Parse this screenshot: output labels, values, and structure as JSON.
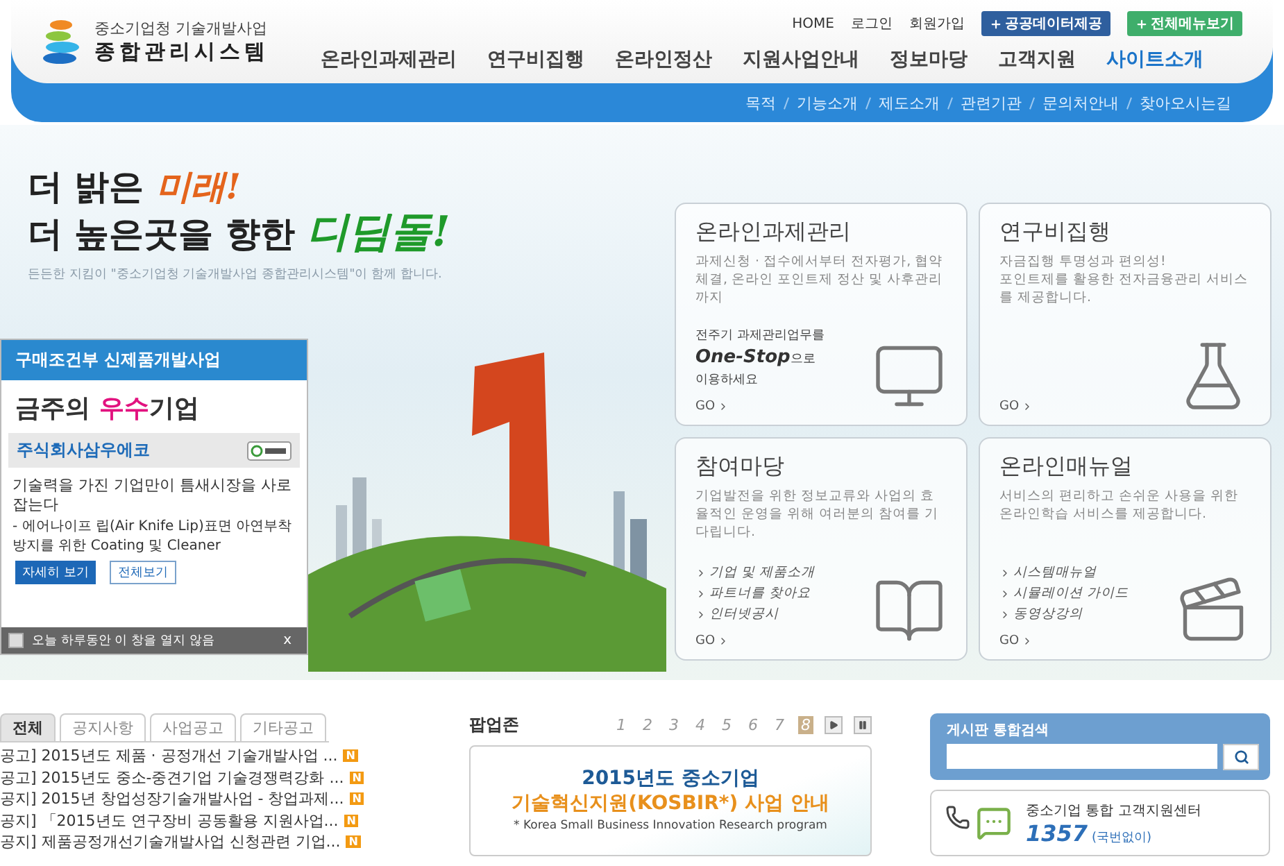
{
  "header": {
    "logo": {
      "org": "중소기업청 기술개발사업",
      "system": "종합관리시스템"
    },
    "top_links": [
      "HOME",
      "로그인",
      "회원가입"
    ],
    "top_buttons": [
      {
        "label": "공공데이터제공",
        "kind": "data"
      },
      {
        "label": "전체메뉴보기",
        "kind": "menu"
      }
    ],
    "nav": [
      {
        "label": "온라인과제관리",
        "selected": false
      },
      {
        "label": "연구비집행",
        "selected": false
      },
      {
        "label": "온라인정산",
        "selected": false
      },
      {
        "label": "지원사업안내",
        "selected": false
      },
      {
        "label": "정보마당",
        "selected": false
      },
      {
        "label": "고객지원",
        "selected": false
      },
      {
        "label": "사이트소개",
        "selected": true
      }
    ],
    "subnav": [
      "목적",
      "기능소개",
      "제도소개",
      "관련기관",
      "문의처안내",
      "찾아오시는길"
    ]
  },
  "hero": {
    "slogan": [
      {
        "lead": "더 밝은",
        "accent": "미래!",
        "color": "#e4641c"
      },
      {
        "lead": "더 높은곳을 향한",
        "accent": "디딤돌!",
        "color": "#1f9a2a"
      }
    ],
    "tagline": "든든한 지킴이 \"중소기업청 기술개발사업 종합관리시스템\"이 함께 합니다."
  },
  "popup": {
    "header": "구매조건부 신제품개발사업",
    "title": {
      "lead": "금주의",
      "accent": "우수",
      "tail": "기업"
    },
    "company": "주식회사삼우에코",
    "description": "기술력을 가진 기업만이 틈새시장을 사로잡는다",
    "detail": "- 에어나이프 립(Air Knife Lip)표면 아연부착방지를 위한 Coating 및 Cleaner",
    "buttons": [
      {
        "label": "자세히 보기",
        "kind": "primary"
      },
      {
        "label": "전체보기",
        "kind": "secondary"
      }
    ],
    "footer": {
      "label": "오늘 하루동안 이 창을 열지 않음",
      "checked": false,
      "close": "x"
    }
  },
  "cards": [
    {
      "title": "온라인과제관리",
      "description": "과제신청 · 접수에서부터 전자평가, 협약체결, 온라인 포인트제 정산 및 사후관리까지",
      "kind": "promo",
      "promo": {
        "line1": "전주기 과제관리업무를",
        "highlight": "One-Stop",
        "suffix": "으로",
        "line3": "이용하세요"
      },
      "go": "GO"
    },
    {
      "title": "연구비집행",
      "description": "자금집행 투명성과 편의성!\n포인트제를 활용한 전자금융관리 서비스를 제공합니다.",
      "kind": "plain",
      "go": "GO"
    },
    {
      "title": "참여마당",
      "description": "기업발전을 위한 정보교류와 사업의 효율적인 운영을 위해 여러분의 참여를 기다립니다.",
      "kind": "links",
      "links": [
        "기업 및 제품소개",
        "파트너를 찾아요",
        "인터넷공시"
      ],
      "go": "GO"
    },
    {
      "title": "온라인매뉴얼",
      "description": "서비스의 편리하고 손쉬운 사용을 위한 온라인학습 서비스를 제공합니다.",
      "kind": "links",
      "links": [
        "시스템매뉴얼",
        "시뮬레이션 가이드",
        "동영상강의"
      ],
      "go": "GO"
    }
  ],
  "notices": {
    "tabs": [
      {
        "label": "전체",
        "selected": true
      },
      {
        "label": "공지사항",
        "selected": false
      },
      {
        "label": "사업공고",
        "selected": false
      },
      {
        "label": "기타공고",
        "selected": false
      }
    ],
    "rows": [
      {
        "text": "공고] 2015년도 제품 · 공정개선 기술개발사업 ...",
        "badge": "N"
      },
      {
        "text": "공고] 2015년도 중소-중견기업 기술경쟁력강화 ...",
        "badge": "N"
      },
      {
        "text": "공지] 2015년 창업성장기술개발사업 - 창업과제...",
        "badge": "N"
      },
      {
        "text": "공지] 「2015년도 연구장비 공동활용 지원사업...",
        "badge": "N"
      },
      {
        "text": "공지] 제품공정개선기술개발사업 신청관련 기업...",
        "badge": "N"
      }
    ]
  },
  "popup_zone": {
    "title": "팝업존",
    "pages": [
      {
        "label": "1",
        "selected": false
      },
      {
        "label": "2",
        "selected": false
      },
      {
        "label": "3",
        "selected": false
      },
      {
        "label": "4",
        "selected": false
      },
      {
        "label": "5",
        "selected": false
      },
      {
        "label": "6",
        "selected": false
      },
      {
        "label": "7",
        "selected": false
      },
      {
        "label": "8",
        "selected": true
      }
    ],
    "banner": {
      "line1": "2015년도 중소기업",
      "line2": "기술혁신지원(KOSBIR*) 사업 안내",
      "line3": "* Korea Small Business Innovation Research program"
    }
  },
  "search": {
    "title": "게시판 통합검색"
  },
  "support": {
    "title": "중소기업 통합 고객지원센터",
    "number": "1357",
    "note": "(국번없이)"
  }
}
